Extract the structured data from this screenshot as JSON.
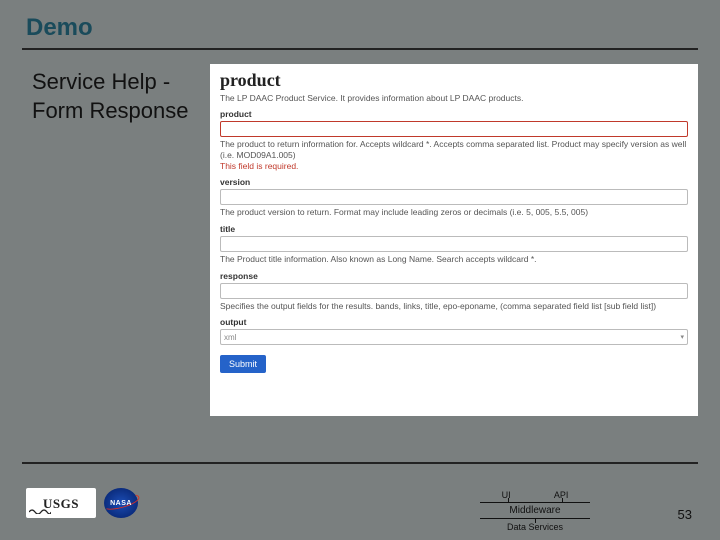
{
  "slide": {
    "title": "Demo",
    "side_label": "Service Help - Form Response",
    "page_number": "53"
  },
  "panel": {
    "heading": "product",
    "description": "The LP DAAC Product Service. It provides information about LP DAAC products.",
    "fields": {
      "product": {
        "label": "product",
        "help": "The product to return information for. Accepts wildcard *. Accepts comma separated list. Product may specify version as well (i.e. MOD09A1.005)",
        "error": "This field is required."
      },
      "version": {
        "label": "version",
        "help": "The product version to return. Format may include leading zeros or decimals (i.e. 5, 005, 5.5, 005)"
      },
      "title": {
        "label": "title",
        "help": "The Product title information. Also known as Long Name. Search accepts wildcard *."
      },
      "response": {
        "label": "response",
        "help": "Specifies the output fields for the results. bands, links, title, epo-eponame, (comma separated field list [sub field list])"
      },
      "output": {
        "label": "output",
        "selected": "xml"
      }
    },
    "submit_label": "Submit"
  },
  "footer": {
    "logos": {
      "usgs": "USGS",
      "nasa": "NASA"
    },
    "stack": {
      "ui": "UI",
      "api": "API",
      "middleware": "Middleware",
      "data_services": "Data Services"
    }
  }
}
